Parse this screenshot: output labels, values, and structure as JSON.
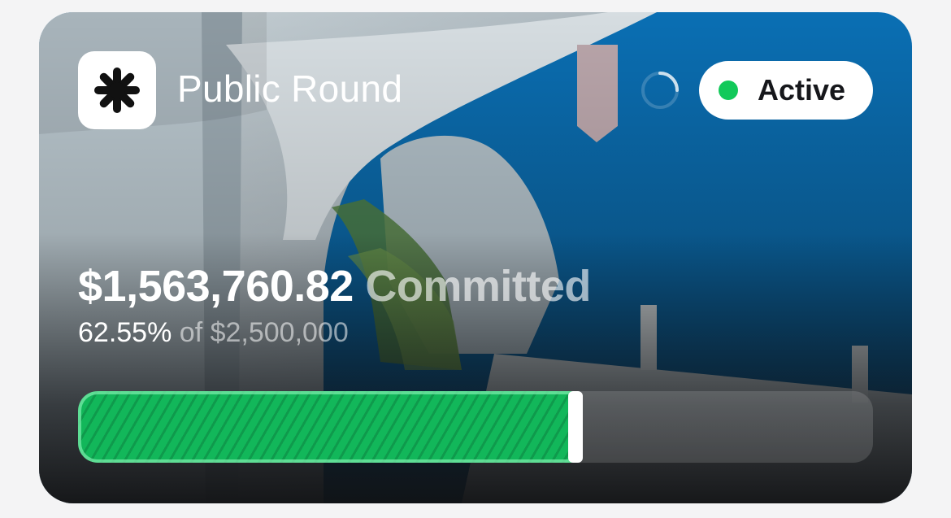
{
  "round": {
    "title": "Public Round",
    "logo_icon": "asterisk-burst-icon",
    "loading_icon": "loading-spinner-icon"
  },
  "status": {
    "label": "Active",
    "color": "#12c95a"
  },
  "funding": {
    "committed_amount": "$1,563,760.82",
    "committed_suffix": "Committed",
    "percent_label": "62.55%",
    "target_label": "of $2,500,000",
    "progress_fraction": 0.6255,
    "bar_color": "#12b75a"
  }
}
